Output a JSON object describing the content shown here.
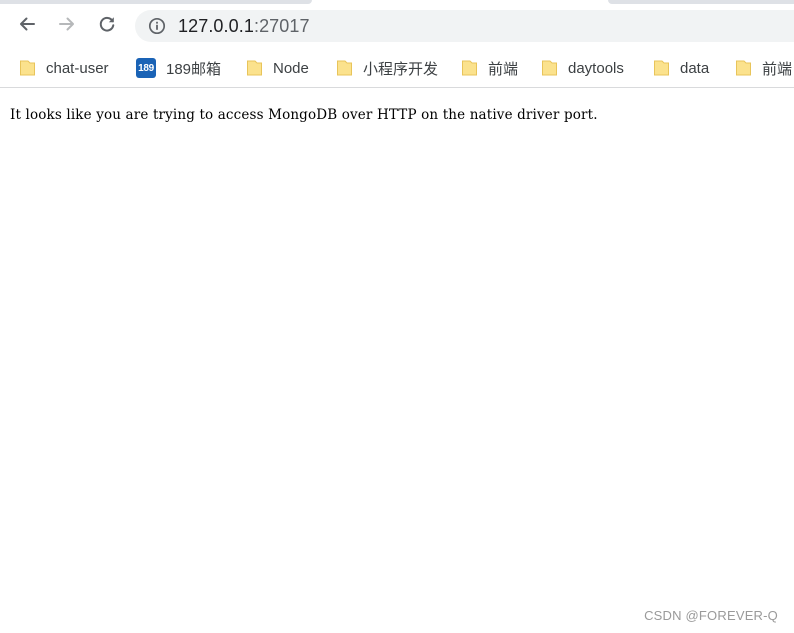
{
  "browser": {
    "url_host": "127.0.0.1",
    "url_port": ":27017",
    "icons": {
      "back": "arrow-left-icon",
      "forward": "arrow-right-icon",
      "reload": "reload-icon",
      "site_info": "info-icon"
    }
  },
  "bookmarks": [
    {
      "label": "chat-user",
      "icon": "folder-icon"
    },
    {
      "label": "189邮箱",
      "icon": "mail-189-icon",
      "icon_text": "189"
    },
    {
      "label": "Node",
      "icon": "folder-icon"
    },
    {
      "label": "小程序开发",
      "icon": "folder-icon"
    },
    {
      "label": "前端",
      "icon": "folder-icon"
    },
    {
      "label": "daytools",
      "icon": "folder-icon"
    },
    {
      "label": "data",
      "icon": "folder-icon"
    },
    {
      "label": "前端",
      "icon": "folder-icon"
    }
  ],
  "page": {
    "message": "It looks like you are trying to access MongoDB over HTTP on the native driver port."
  },
  "watermark": "CSDN @FOREVER-Q",
  "colors": {
    "folder_fill": "#fbe28d",
    "folder_stroke": "#e8c45a",
    "mail_badge": "#1a63b6",
    "omnibox_bg": "#f1f3f4"
  }
}
